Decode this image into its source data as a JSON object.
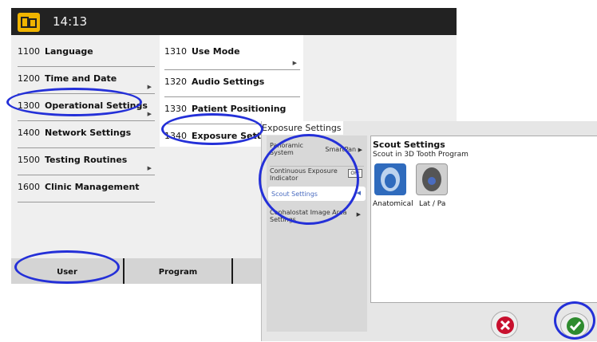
{
  "clock": "14:13",
  "menu_level1": [
    {
      "num": "1100",
      "label": "Language",
      "arrow": false
    },
    {
      "num": "1200",
      "label": "Time and Date",
      "arrow": true
    },
    {
      "num": "1300",
      "label": "Operational Settings",
      "arrow": true
    },
    {
      "num": "1400",
      "label": "Network Settings",
      "arrow": false
    },
    {
      "num": "1500",
      "label": "Testing Routines",
      "arrow": true
    },
    {
      "num": "1600",
      "label": "Clinic Management",
      "arrow": false
    }
  ],
  "menu_level2": [
    {
      "num": "1310",
      "label": "Use Mode",
      "arrow": true
    },
    {
      "num": "1320",
      "label": "Audio Settings",
      "arrow": false
    },
    {
      "num": "1330",
      "label": "Patient Positioning",
      "arrow": false
    },
    {
      "num": "1340",
      "label": "Exposure Settings",
      "arrow": false
    }
  ],
  "tabs": {
    "user": "User",
    "program": "Program"
  },
  "exposure_panel": {
    "title": "Exposure Settings",
    "items": {
      "panoramic_line1": "Panoramic",
      "panoramic_line2": "System",
      "panoramic_value": "SmartPan",
      "continuous_line1": "Continuous Exposure",
      "continuous_line2": "Indicator",
      "continuous_toggle": "OFF",
      "scout": "Scout Settings",
      "ceph_line1": "Cephalostat Image Area",
      "ceph_line2": "Settings"
    },
    "scout_settings": {
      "title": "Scout Settings",
      "subtitle": "Scout in 3D Tooth Program",
      "options": [
        "Anatomical",
        "Lat / Pa"
      ]
    }
  },
  "colors": {
    "highlight": "#2430d8",
    "accent": "#4a6cc0",
    "logo": "#f0b400"
  }
}
